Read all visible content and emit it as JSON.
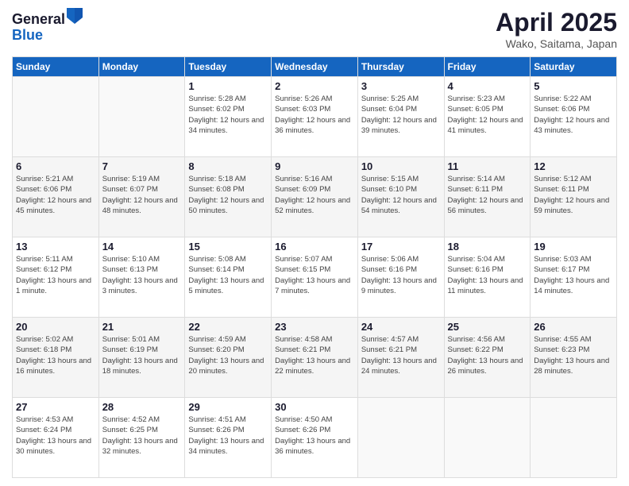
{
  "header": {
    "logo_general": "General",
    "logo_blue": "Blue",
    "month_title": "April 2025",
    "location": "Wako, Saitama, Japan"
  },
  "days_of_week": [
    "Sunday",
    "Monday",
    "Tuesday",
    "Wednesday",
    "Thursday",
    "Friday",
    "Saturday"
  ],
  "weeks": [
    [
      {
        "day": "",
        "empty": true
      },
      {
        "day": "",
        "empty": true
      },
      {
        "day": "1",
        "sunrise": "Sunrise: 5:28 AM",
        "sunset": "Sunset: 6:02 PM",
        "daylight": "Daylight: 12 hours and 34 minutes."
      },
      {
        "day": "2",
        "sunrise": "Sunrise: 5:26 AM",
        "sunset": "Sunset: 6:03 PM",
        "daylight": "Daylight: 12 hours and 36 minutes."
      },
      {
        "day": "3",
        "sunrise": "Sunrise: 5:25 AM",
        "sunset": "Sunset: 6:04 PM",
        "daylight": "Daylight: 12 hours and 39 minutes."
      },
      {
        "day": "4",
        "sunrise": "Sunrise: 5:23 AM",
        "sunset": "Sunset: 6:05 PM",
        "daylight": "Daylight: 12 hours and 41 minutes."
      },
      {
        "day": "5",
        "sunrise": "Sunrise: 5:22 AM",
        "sunset": "Sunset: 6:06 PM",
        "daylight": "Daylight: 12 hours and 43 minutes."
      }
    ],
    [
      {
        "day": "6",
        "sunrise": "Sunrise: 5:21 AM",
        "sunset": "Sunset: 6:06 PM",
        "daylight": "Daylight: 12 hours and 45 minutes."
      },
      {
        "day": "7",
        "sunrise": "Sunrise: 5:19 AM",
        "sunset": "Sunset: 6:07 PM",
        "daylight": "Daylight: 12 hours and 48 minutes."
      },
      {
        "day": "8",
        "sunrise": "Sunrise: 5:18 AM",
        "sunset": "Sunset: 6:08 PM",
        "daylight": "Daylight: 12 hours and 50 minutes."
      },
      {
        "day": "9",
        "sunrise": "Sunrise: 5:16 AM",
        "sunset": "Sunset: 6:09 PM",
        "daylight": "Daylight: 12 hours and 52 minutes."
      },
      {
        "day": "10",
        "sunrise": "Sunrise: 5:15 AM",
        "sunset": "Sunset: 6:10 PM",
        "daylight": "Daylight: 12 hours and 54 minutes."
      },
      {
        "day": "11",
        "sunrise": "Sunrise: 5:14 AM",
        "sunset": "Sunset: 6:11 PM",
        "daylight": "Daylight: 12 hours and 56 minutes."
      },
      {
        "day": "12",
        "sunrise": "Sunrise: 5:12 AM",
        "sunset": "Sunset: 6:11 PM",
        "daylight": "Daylight: 12 hours and 59 minutes."
      }
    ],
    [
      {
        "day": "13",
        "sunrise": "Sunrise: 5:11 AM",
        "sunset": "Sunset: 6:12 PM",
        "daylight": "Daylight: 13 hours and 1 minute."
      },
      {
        "day": "14",
        "sunrise": "Sunrise: 5:10 AM",
        "sunset": "Sunset: 6:13 PM",
        "daylight": "Daylight: 13 hours and 3 minutes."
      },
      {
        "day": "15",
        "sunrise": "Sunrise: 5:08 AM",
        "sunset": "Sunset: 6:14 PM",
        "daylight": "Daylight: 13 hours and 5 minutes."
      },
      {
        "day": "16",
        "sunrise": "Sunrise: 5:07 AM",
        "sunset": "Sunset: 6:15 PM",
        "daylight": "Daylight: 13 hours and 7 minutes."
      },
      {
        "day": "17",
        "sunrise": "Sunrise: 5:06 AM",
        "sunset": "Sunset: 6:16 PM",
        "daylight": "Daylight: 13 hours and 9 minutes."
      },
      {
        "day": "18",
        "sunrise": "Sunrise: 5:04 AM",
        "sunset": "Sunset: 6:16 PM",
        "daylight": "Daylight: 13 hours and 11 minutes."
      },
      {
        "day": "19",
        "sunrise": "Sunrise: 5:03 AM",
        "sunset": "Sunset: 6:17 PM",
        "daylight": "Daylight: 13 hours and 14 minutes."
      }
    ],
    [
      {
        "day": "20",
        "sunrise": "Sunrise: 5:02 AM",
        "sunset": "Sunset: 6:18 PM",
        "daylight": "Daylight: 13 hours and 16 minutes."
      },
      {
        "day": "21",
        "sunrise": "Sunrise: 5:01 AM",
        "sunset": "Sunset: 6:19 PM",
        "daylight": "Daylight: 13 hours and 18 minutes."
      },
      {
        "day": "22",
        "sunrise": "Sunrise: 4:59 AM",
        "sunset": "Sunset: 6:20 PM",
        "daylight": "Daylight: 13 hours and 20 minutes."
      },
      {
        "day": "23",
        "sunrise": "Sunrise: 4:58 AM",
        "sunset": "Sunset: 6:21 PM",
        "daylight": "Daylight: 13 hours and 22 minutes."
      },
      {
        "day": "24",
        "sunrise": "Sunrise: 4:57 AM",
        "sunset": "Sunset: 6:21 PM",
        "daylight": "Daylight: 13 hours and 24 minutes."
      },
      {
        "day": "25",
        "sunrise": "Sunrise: 4:56 AM",
        "sunset": "Sunset: 6:22 PM",
        "daylight": "Daylight: 13 hours and 26 minutes."
      },
      {
        "day": "26",
        "sunrise": "Sunrise: 4:55 AM",
        "sunset": "Sunset: 6:23 PM",
        "daylight": "Daylight: 13 hours and 28 minutes."
      }
    ],
    [
      {
        "day": "27",
        "sunrise": "Sunrise: 4:53 AM",
        "sunset": "Sunset: 6:24 PM",
        "daylight": "Daylight: 13 hours and 30 minutes."
      },
      {
        "day": "28",
        "sunrise": "Sunrise: 4:52 AM",
        "sunset": "Sunset: 6:25 PM",
        "daylight": "Daylight: 13 hours and 32 minutes."
      },
      {
        "day": "29",
        "sunrise": "Sunrise: 4:51 AM",
        "sunset": "Sunset: 6:26 PM",
        "daylight": "Daylight: 13 hours and 34 minutes."
      },
      {
        "day": "30",
        "sunrise": "Sunrise: 4:50 AM",
        "sunset": "Sunset: 6:26 PM",
        "daylight": "Daylight: 13 hours and 36 minutes."
      },
      {
        "day": "",
        "empty": true
      },
      {
        "day": "",
        "empty": true
      },
      {
        "day": "",
        "empty": true
      }
    ]
  ]
}
